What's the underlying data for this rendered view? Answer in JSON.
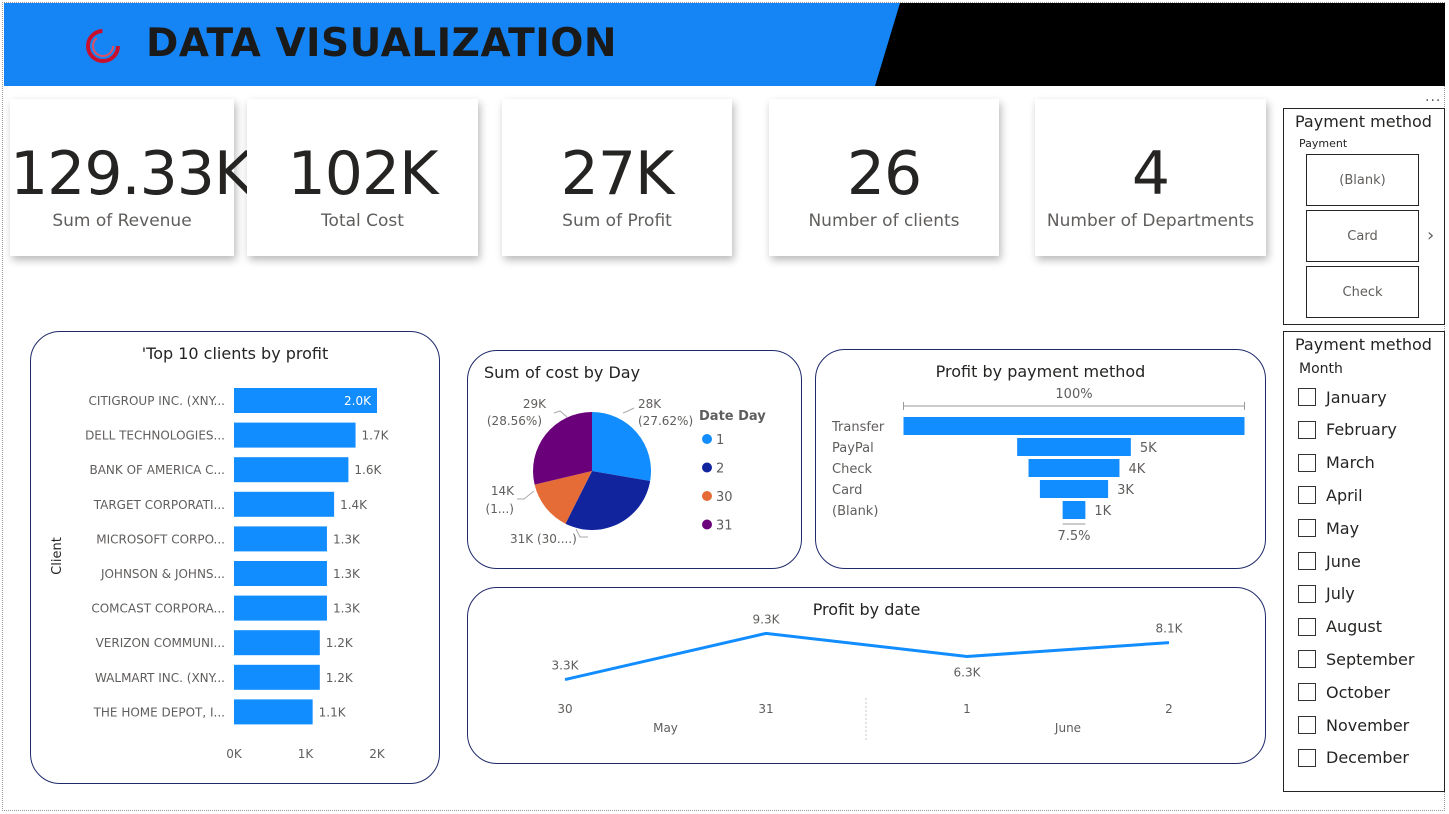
{
  "header": {
    "title": "DATA VISUALIZATION"
  },
  "kpis": [
    {
      "value": "129.33K",
      "label": "Sum of Revenue"
    },
    {
      "value": "102K",
      "label": "Total Cost"
    },
    {
      "value": "27K",
      "label": "Sum of Profit"
    },
    {
      "value": "26",
      "label": "Number of clients"
    },
    {
      "value": "4",
      "label": "Number of Departments"
    }
  ],
  "payment_slicer": {
    "title": "Payment method",
    "subtitle": "Payment",
    "tiles": [
      "(Blank)",
      "Card",
      "Check"
    ],
    "more": "..."
  },
  "month_slicer": {
    "title": "Payment method",
    "subtitle": "Month",
    "months": [
      "January",
      "February",
      "March",
      "April",
      "May",
      "June",
      "July",
      "August",
      "September",
      "October",
      "November",
      "December"
    ]
  },
  "colors": {
    "accent": "#1585f5",
    "bar": "#118dff",
    "pie_1": "#118dff",
    "pie_2": "#12239e",
    "pie_30": "#e66c37",
    "pie_31": "#6b007b",
    "panel_border": "#1f2a6b"
  },
  "chart_data": [
    {
      "id": "top-clients",
      "type": "bar",
      "orientation": "horizontal",
      "title": "'Top 10 clients by profit",
      "ylabel": "Client",
      "categories": [
        "CITIGROUP INC. (XNY...",
        "DELL TECHNOLOGIES...",
        "BANK OF AMERICA C...",
        "TARGET CORPORATI...",
        "MICROSOFT CORPO...",
        "JOHNSON & JOHNS...",
        "COMCAST CORPORA...",
        "VERIZON COMMUNI...",
        "WALMART INC. (XNY...",
        "THE HOME DEPOT, I..."
      ],
      "values": [
        2000,
        1700,
        1600,
        1400,
        1300,
        1300,
        1300,
        1200,
        1200,
        1100
      ],
      "data_labels": [
        "2.0K",
        "1.7K",
        "1.6K",
        "1.4K",
        "1.3K",
        "1.3K",
        "1.3K",
        "1.2K",
        "1.2K",
        "1.1K"
      ],
      "xlim": [
        0,
        2000
      ],
      "xticks": [
        "0K",
        "1K",
        "2K"
      ]
    },
    {
      "id": "cost-by-day",
      "type": "pie",
      "title": "Sum of cost by Day",
      "legend_title": "Date Day",
      "legend_placement": "right",
      "slices": [
        {
          "name": "1",
          "value": 28000,
          "label": [
            "28K",
            "(27.62%)"
          ]
        },
        {
          "name": "2",
          "value": 30000,
          "label": []
        },
        {
          "name": "30",
          "value": 14000,
          "label": [
            "14K",
            "(1...)"
          ]
        },
        {
          "name": "31",
          "value": 29000,
          "label": [
            "29K",
            "(28.56%)"
          ]
        }
      ],
      "extra_labels": [
        "31K (30....)"
      ]
    },
    {
      "id": "profit-by-payment",
      "type": "bar",
      "subtype": "funnel",
      "title": "Profit by payment method",
      "categories": [
        "Transfer",
        "PayPal",
        "Check",
        "Card",
        "(Blank)"
      ],
      "values": [
        15000,
        5000,
        4000,
        3000,
        1000
      ],
      "data_labels": [
        "",
        "5K",
        "4K",
        "3K",
        "1K"
      ],
      "top_pct": "100%",
      "bottom_pct": "7.5%"
    },
    {
      "id": "profit-by-date",
      "type": "line",
      "title": "Profit by date",
      "x": [
        "30",
        "31",
        "1",
        "2"
      ],
      "x_groups": [
        {
          "name": "May",
          "span": [
            0,
            1
          ]
        },
        {
          "name": "June",
          "span": [
            2,
            3
          ]
        }
      ],
      "values": [
        3300,
        9300,
        6300,
        8100
      ],
      "data_labels": [
        "3.3K",
        "9.3K",
        "6.3K",
        "8.1K"
      ],
      "ylim": [
        0,
        10000
      ]
    }
  ]
}
